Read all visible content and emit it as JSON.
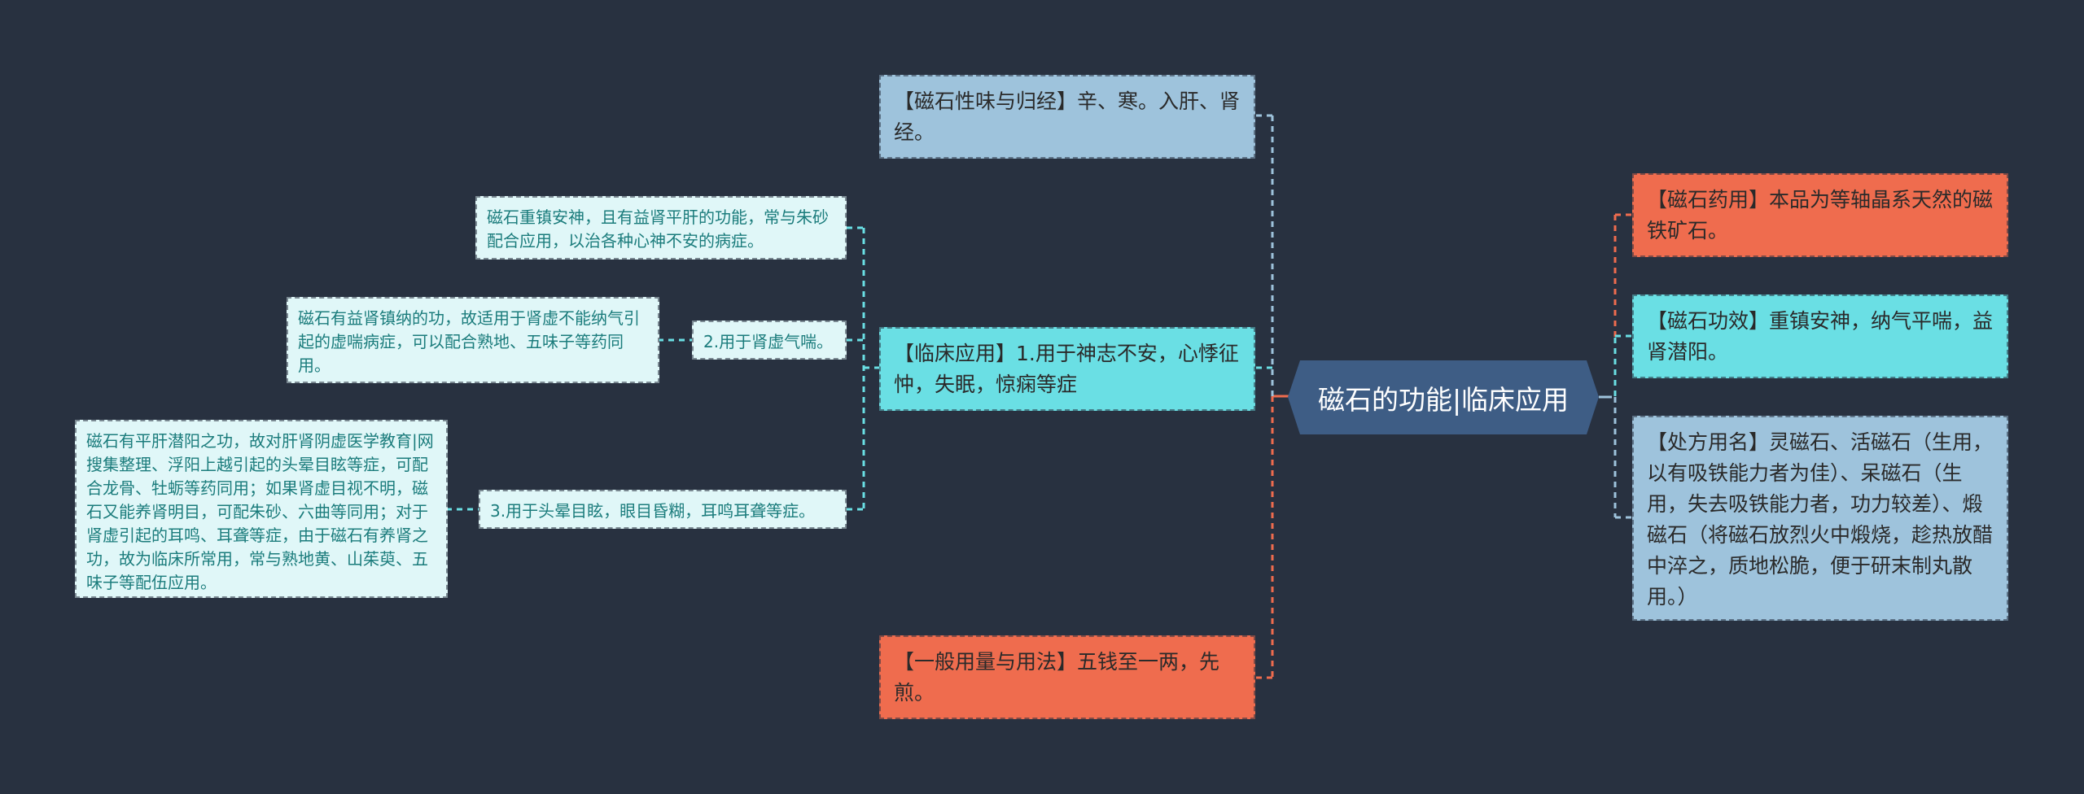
{
  "colors": {
    "background": "#283140",
    "center": "#3e5d85",
    "blue": "#9ec3dc",
    "cyan": "#6adfe4",
    "orange": "#ef6c4e",
    "leaf": "#e0f7f8",
    "leaf_text": "#1b7c7c"
  },
  "center": {
    "label": "磁石的功能|临床应用"
  },
  "right": [
    {
      "id": "yaoyong",
      "text": "【磁石药用】本品为等轴晶系天然的磁铁矿石。"
    },
    {
      "id": "gongxiao",
      "text": "【磁石功效】重镇安神，纳气平喘，益肾潜阳。"
    },
    {
      "id": "chufang",
      "text": "【处方用名】灵磁石、活磁石（生用，以有吸铁能力者为佳）、呆磁石（生用，失去吸铁能力者，功力较差）、煅磁石（将磁石放烈火中煅烧，趁热放醋中淬之，质地松脆，便于研末制丸散用。）"
    }
  ],
  "left": [
    {
      "id": "xingwei",
      "text": "【磁石性味与归经】辛、寒。入肝、肾经。"
    },
    {
      "id": "linchuang",
      "text": "【临床应用】1.用于神志不安，心悸征忡，失眠，惊痫等症"
    },
    {
      "id": "yongliang",
      "text": "【一般用量与用法】五钱至一两，先煎。"
    }
  ],
  "linchuang_children": [
    {
      "id": "c1",
      "text": "磁石重镇安神，且有益肾平肝的功能，常与朱砂配合应用，以治各种心神不安的病症。"
    },
    {
      "id": "c2",
      "text": "2.用于肾虚气喘。"
    },
    {
      "id": "c3",
      "text": "3.用于头晕目眩，眼目昏糊，耳鸣耳聋等症。"
    }
  ],
  "grandchildren": [
    {
      "id": "g2",
      "text": "磁石有益肾镇纳的功，故适用于肾虚不能纳气引起的虚喘病症，可以配合熟地、五味子等药同用。"
    },
    {
      "id": "g3",
      "text": "磁石有平肝潜阳之功，故对肝肾阴虚医学教育|网搜集整理、浮阳上越引起的头晕目眩等症，可配合龙骨、牡蛎等药同用；如果肾虚目视不明，磁石又能养肾明目，可配朱砂、六曲等同用；对于肾虚引起的耳鸣、耳聋等症，由于磁石有养肾之功，故为临床所常用，常与熟地黄、山茱萸、五味子等配伍应用。"
    }
  ]
}
